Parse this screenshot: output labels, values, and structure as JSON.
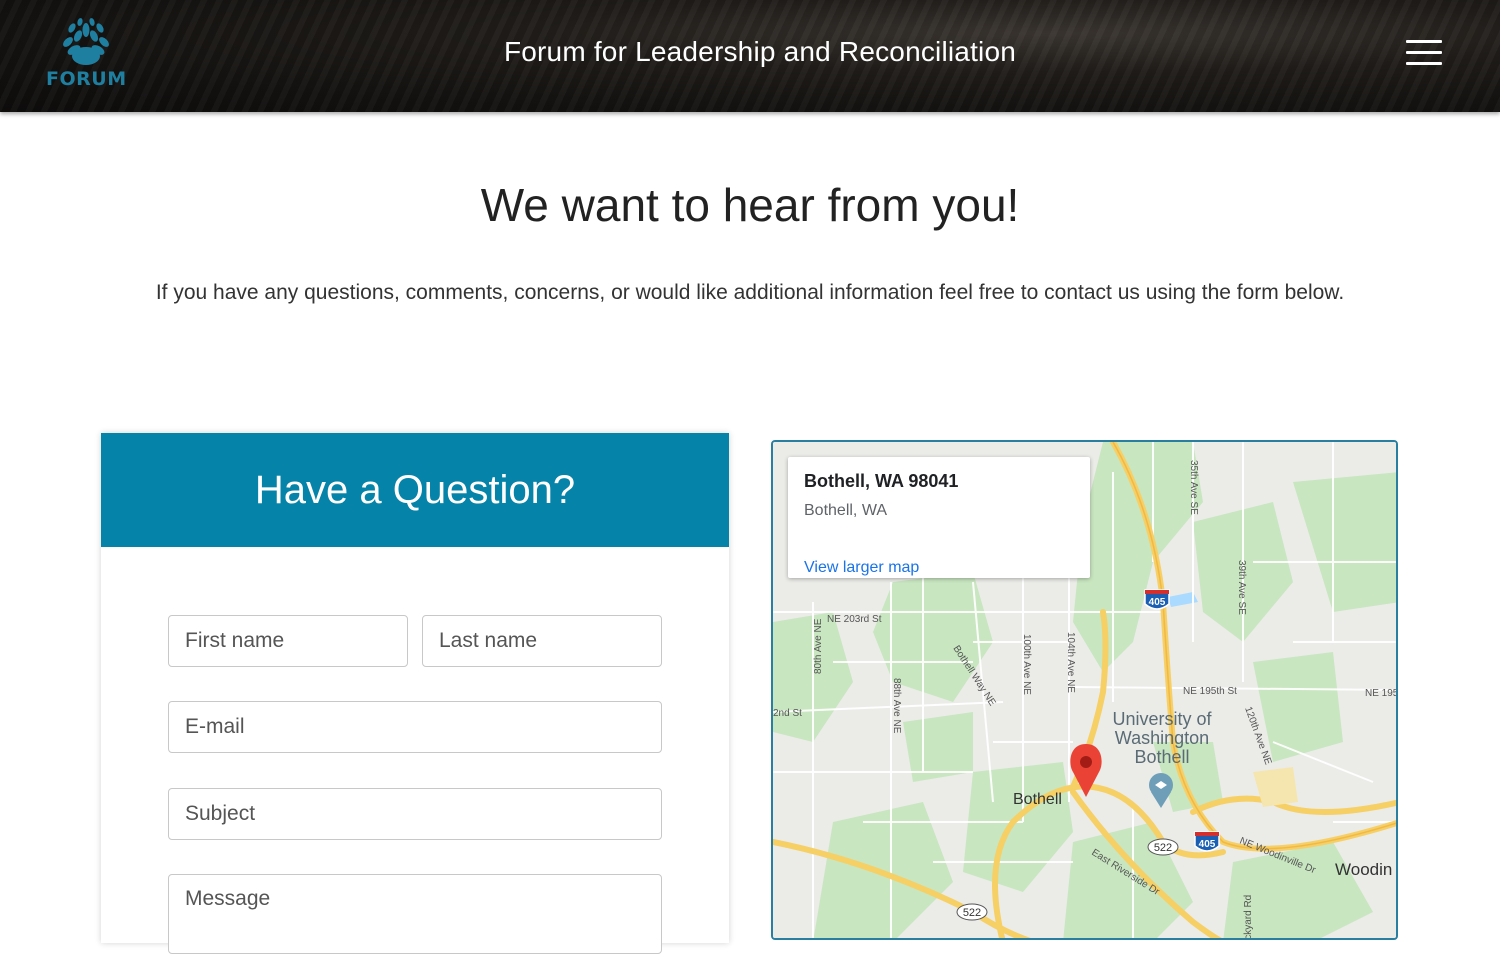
{
  "header": {
    "logo_text": "FORUM",
    "title": "Forum for Leadership and Reconciliation",
    "menu_icon": "hamburger-menu-icon"
  },
  "main": {
    "heading": "We want to hear from you!",
    "intro": "If you have any questions, comments, concerns, or would like additional information feel free to contact us using the form below."
  },
  "form": {
    "title": "Have a Question?",
    "first_name_placeholder": "First name",
    "last_name_placeholder": "Last name",
    "email_placeholder": "E-mail",
    "subject_placeholder": "Subject",
    "message_placeholder": "Message"
  },
  "map": {
    "info_title": "Bothell, WA 98041",
    "info_subtitle": "Bothell, WA",
    "info_link": "View larger map",
    "labels": {
      "ne_203rd": "NE 203rd St",
      "ave_80th": "80th Ave NE",
      "ave_88th": "88th Ave NE",
      "ave_100th": "100th Ave NE",
      "ave_104th": "104th Ave NE",
      "bothell_way": "Bothell Way NE",
      "ave_35th": "35th Ave SE",
      "ave_39th": "39th Ave SE",
      "ave_120th": "120th Ave NE",
      "ne_195th": "NE 195th St",
      "ne_195_cut": "NE 195",
      "nd_st": "2nd St",
      "uw1": "University of",
      "uw2": "Washington",
      "uw3": "Bothell",
      "bothell": "Bothell",
      "east_riverside": "East Riverside Dr",
      "ne_woodinville": "NE Woodinville Dr",
      "woodin": "Woodin",
      "kirkyard": "ickyard Rd",
      "i405_a": "405",
      "i405_b": "405",
      "sr522_a": "522",
      "sr522_b": "522",
      "pin_icon": "map-pin-icon",
      "campus_icon": "university-marker-icon"
    }
  }
}
